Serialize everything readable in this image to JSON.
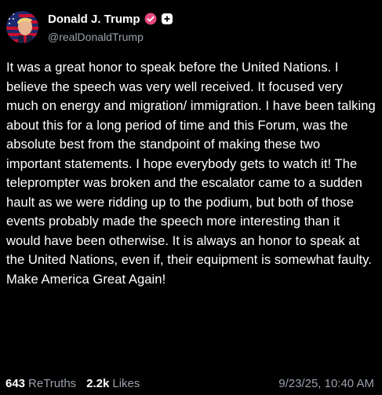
{
  "post": {
    "author": {
      "display_name": "Donald J. Trump",
      "handle": "@realDonaldTrump",
      "avatar_icon": "avatar-flag-portrait",
      "verified_icon": "verified-badge-icon",
      "follow_icon": "plus-icon"
    },
    "body": "It was a great honor to speak before the United Nations. I believe the speech was very well received. It focused very much on energy and migration/ immigration. I have been talking about this for a long period of time and this Forum, was the absolute best from the standpoint of making these two important statements. I hope everybody gets to watch it! The teleprompter was broken and the escalator came to a sudden hault as we were ridding up to the podium, but both of those events probably made the speech more interesting than it would have been otherwise. It is always an honor to speak at the United Nations, even if, their equipment is somewhat faulty. Make America Great Again!",
    "stats": {
      "retruths_count": "643",
      "retruths_label": "ReTruths",
      "likes_count": "2.2k",
      "likes_label": "Likes"
    },
    "timestamp": "9/23/25, 10:40 AM"
  },
  "colors": {
    "background": "#000000",
    "text": "#ffffff",
    "muted": "#9aa0ab",
    "verified": "#e5487b"
  }
}
